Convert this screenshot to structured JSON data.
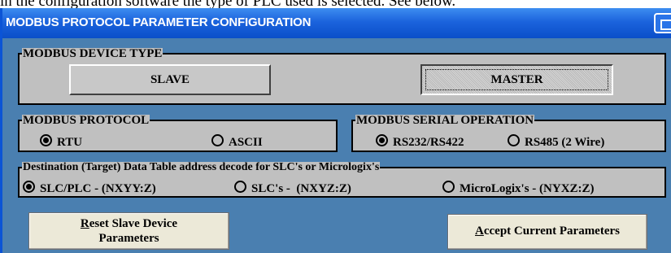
{
  "caption": "in the configuration software the type of PLC used is selected. See below.",
  "window": {
    "title": "MODBUS PROTOCOL PARAMETER CONFIGURATION"
  },
  "device_type": {
    "legend": "MODBUS DEVICE TYPE",
    "slave_label": "SLAVE",
    "master_label": "MASTER",
    "selected": "MASTER"
  },
  "protocol": {
    "legend": "MODBUS PROTOCOL",
    "options": [
      {
        "label": "RTU",
        "selected": true
      },
      {
        "label": "ASCII",
        "selected": false
      }
    ]
  },
  "serial": {
    "legend": "MODBUS SERIAL OPERATION",
    "options": [
      {
        "label": "RS232/RS422",
        "selected": true
      },
      {
        "label": "RS485 (2 Wire)",
        "selected": false
      }
    ]
  },
  "decode": {
    "legend": "Destination (Target) Data Table address decode for SLC's or Micrologix's",
    "options": [
      {
        "label": "SLC/PLC - (NXYY:Z)",
        "selected": true
      },
      {
        "label": "SLC's -  (NXYZ:Z)",
        "selected": false
      },
      {
        "label": "MicroLogix's - (NYXZ:Z)",
        "selected": false
      }
    ]
  },
  "buttons": {
    "reset_line1_hotkey": "R",
    "reset_line1_rest": "eset Slave Device",
    "reset_line2": "Parameters",
    "accept_hotkey": "A",
    "accept_rest": "ccept Current Parameters"
  }
}
